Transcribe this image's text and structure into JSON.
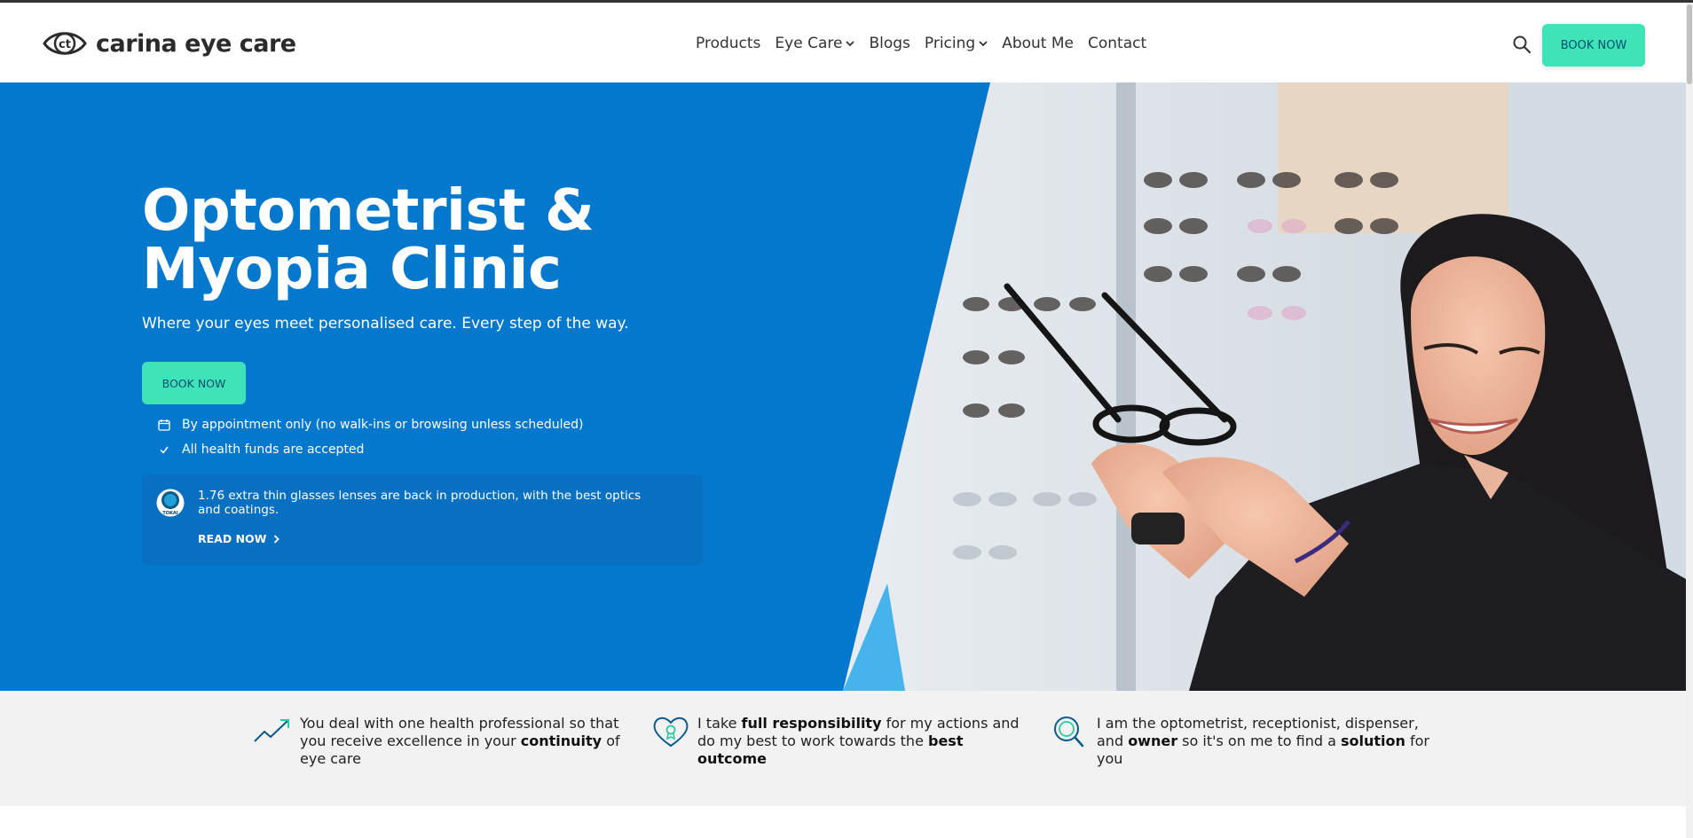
{
  "brand": {
    "name": "carina eye care",
    "mark": "ct"
  },
  "nav": {
    "items": [
      {
        "label": "Products",
        "dropdown": false
      },
      {
        "label": "Eye Care",
        "dropdown": true
      },
      {
        "label": "Blogs",
        "dropdown": false
      },
      {
        "label": "Pricing",
        "dropdown": true
      },
      {
        "label": "About Me",
        "dropdown": false
      },
      {
        "label": "Contact",
        "dropdown": false
      }
    ],
    "search_icon": "search-icon",
    "book_label": "BOOK NOW"
  },
  "hero": {
    "title_line1": "Optometrist &",
    "title_line2": "Myopia Clinic",
    "subtitle": "Where your eyes meet personalised care. Every step of the way.",
    "book_label": "BOOK NOW",
    "features": [
      {
        "icon": "calendar-icon",
        "text": "By appointment only (no walk-ins or browsing unless scheduled)"
      },
      {
        "icon": "check-icon",
        "text": "All health funds are accepted"
      }
    ],
    "news": {
      "logo_text": "TOKAI",
      "text": "1.76 extra thin glasses lenses are back in production, with the best optics and coatings.",
      "link_label": "READ NOW"
    }
  },
  "values": [
    {
      "icon": "trend-up-icon",
      "pre": "You deal with one health professional so that you receive excellence in your ",
      "bold1": "continuity",
      "mid": " of eye care",
      "bold2": "",
      "post": ""
    },
    {
      "icon": "heart-award-icon",
      "pre": "I take ",
      "bold1": "full responsibility",
      "mid": " for my actions and do my best to work towards the ",
      "bold2": "best outcome",
      "post": ""
    },
    {
      "icon": "magnifier-icon",
      "pre": "I am the optometrist, receptionist, dispenser, and ",
      "bold1": "owner",
      "mid": " so it's on me to find a ",
      "bold2": "solution",
      "post": " for you"
    }
  ],
  "colors": {
    "hero_blue": "#0378cc",
    "accent_mint": "#3ee3b8",
    "dark_text": "#0b4d70"
  }
}
